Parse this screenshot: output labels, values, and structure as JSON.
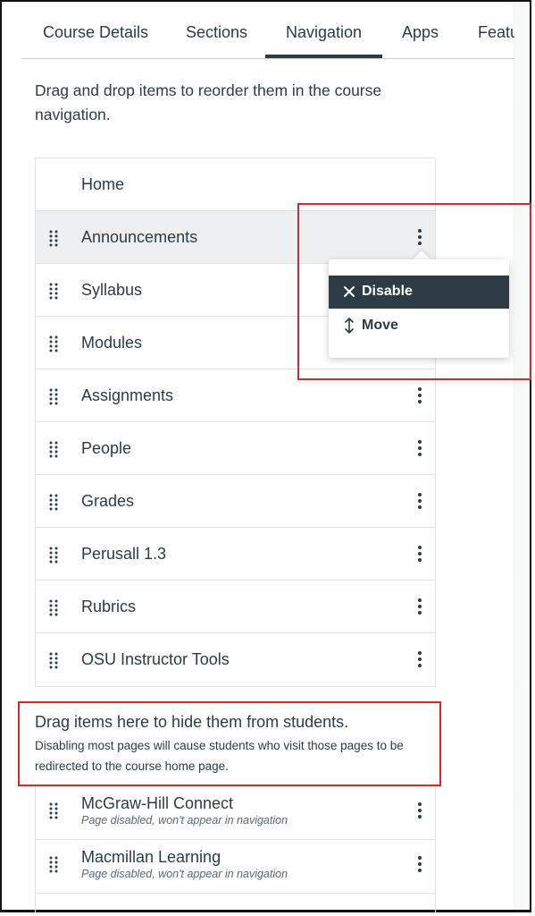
{
  "tabs": [
    {
      "label": "Course Details"
    },
    {
      "label": "Sections"
    },
    {
      "label": "Navigation"
    },
    {
      "label": "Apps"
    },
    {
      "label": "Feature Options"
    }
  ],
  "active_tab": "Navigation",
  "intro": "Drag and drop items to reorder them in the course navigation.",
  "nav_items": [
    {
      "label": "Home"
    },
    {
      "label": "Announcements"
    },
    {
      "label": "Syllabus"
    },
    {
      "label": "Modules"
    },
    {
      "label": "Assignments"
    },
    {
      "label": "People"
    },
    {
      "label": "Grades"
    },
    {
      "label": "Perusall 1.3"
    },
    {
      "label": "Rubrics"
    },
    {
      "label": "OSU Instructor Tools"
    }
  ],
  "menu": {
    "disable_label": "Disable",
    "move_label": "Move"
  },
  "hidden_section": {
    "title": "Drag items here to hide them from students.",
    "description": "Disabling most pages will cause students who visit those pages to be redirected to the course home page."
  },
  "disabled_items": [
    {
      "label": "McGraw-Hill Connect",
      "status": "Page disabled, won't appear in navigation"
    },
    {
      "label": "Macmillan Learning",
      "status": "Page disabled, won't appear in navigation"
    }
  ],
  "colors": {
    "text": "#2d3b45",
    "highlight": "#d9262f",
    "menu_active_bg": "#2d3b45",
    "row_hover_bg": "#eeeff1"
  }
}
